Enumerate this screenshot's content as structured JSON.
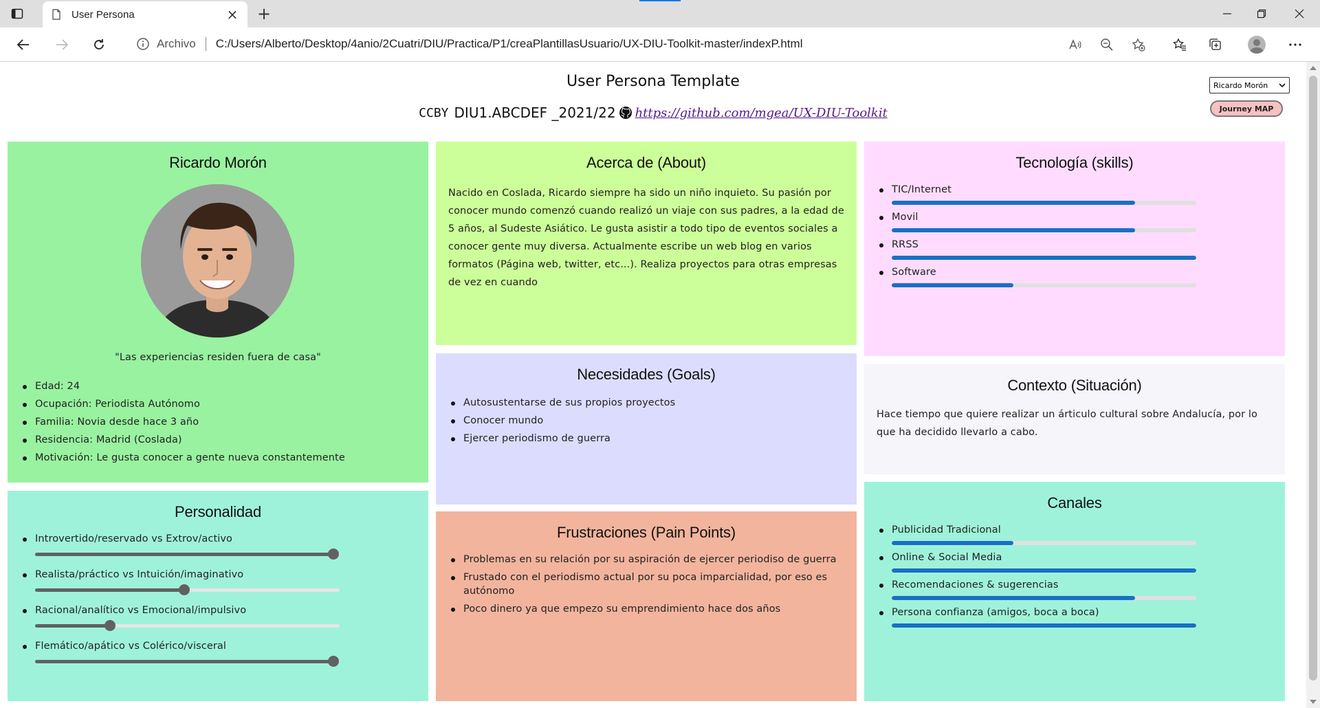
{
  "browser": {
    "tab_title": "User Persona",
    "address_scheme": "Archivo",
    "address_url": "C:/Users/Alberto/Desktop/4anio/2Cuatri/DIU/Practica/P1/creaPlantillasUsuario/UX-DIU-Toolkit-master/indexP.html"
  },
  "header": {
    "title": "User Persona Template",
    "license": "CCBY",
    "course": "DIU1.ABCDEF _2021/22",
    "repo_link": "https://github.com/mgea/UX-DIU-Toolkit",
    "persona_select": "Ricardo Morón",
    "journey_button": "Journey MAP"
  },
  "profile": {
    "name": "Ricardo Morón",
    "quote": "\"Las experiencias residen fuera de casa\"",
    "details": [
      "Edad: 24",
      "Ocupación: Periodista Autónomo",
      "Familia: Novia desde hace 3 año",
      "Residencia: Madrid (Coslada)",
      "Motivación: Le gusta conocer a gente nueva constantemente"
    ]
  },
  "about": {
    "title": "Acerca de (About)",
    "text": "Nacido en Coslada, Ricardo siempre ha sido un niño inquieto. Su pasión por conocer mundo comenzó cuando realizó un viaje con sus padres, a la edad de 5 años, al Sudeste Asiático. Le gusta asistir a todo tipo de eventos sociales a conocer gente muy diversa. Actualmente escribe un web blog en varios formatos (Página web, twitter, etc...). Realiza proyectos para otras empresas de vez en cuando"
  },
  "skills": {
    "title": "Tecnología (skills)",
    "items": [
      {
        "label": "TIC/Internet",
        "level": 0.8
      },
      {
        "label": "Movil",
        "level": 0.8
      },
      {
        "label": "RRSS",
        "level": 1.0
      },
      {
        "label": "Software",
        "level": 0.4
      }
    ]
  },
  "goals": {
    "title": "Necesidades (Goals)",
    "items": [
      "Autosustentarse de sus propios proyectos",
      "Conocer mundo",
      "Ejercer periodismo de guerra"
    ]
  },
  "context": {
    "title": "Contexto (Situación)",
    "text": "Hace tiempo que quiere realizar un árticulo cultural sobre Andalucía, por lo que ha decidido llevarlo a cabo."
  },
  "personality": {
    "title": "Personalidad",
    "items": [
      {
        "label": "Introvertido/reservado vs Extrov/activo",
        "level": 1.0
      },
      {
        "label": "Realista/práctico vs Intuición/imaginativo",
        "level": 0.5
      },
      {
        "label": "Racional/analítico vs Emocional/impulsivo",
        "level": 0.25
      },
      {
        "label": "Flemático/apático vs Colérico/visceral",
        "level": 1.0
      }
    ]
  },
  "frustrations": {
    "title": "Frustraciones (Pain Points)",
    "items": [
      "Problemas en su relación por su aspiración de ejercer periodiso de guerra",
      "Frustado con el periodismo actual por su poca imparcialidad, por eso es autónomo",
      "Poco dinero ya que empezo su emprendimiento hace dos años"
    ]
  },
  "channels": {
    "title": "Canales",
    "items": [
      {
        "label": "Publicidad Tradicional",
        "level": 0.4
      },
      {
        "label": "Online & Social Media",
        "level": 1.0
      },
      {
        "label": "Recomendaciones & sugerencias",
        "level": 0.8
      },
      {
        "label": "Persona confianza (amigos, boca a boca)",
        "level": 1.0
      }
    ]
  },
  "colors": {
    "profile_bg": "#99f2a0",
    "about_bg": "#ccff99",
    "skills_bg": "#ffdcff",
    "goals_bg": "#dcdcff",
    "context_bg": "#f5f5fa",
    "personality_bg": "#9ff2da",
    "frustrations_bg": "#f2b49c",
    "channels_bg": "#9ff2da",
    "progress_fill": "#1a6fc4",
    "slider": "#616161"
  }
}
